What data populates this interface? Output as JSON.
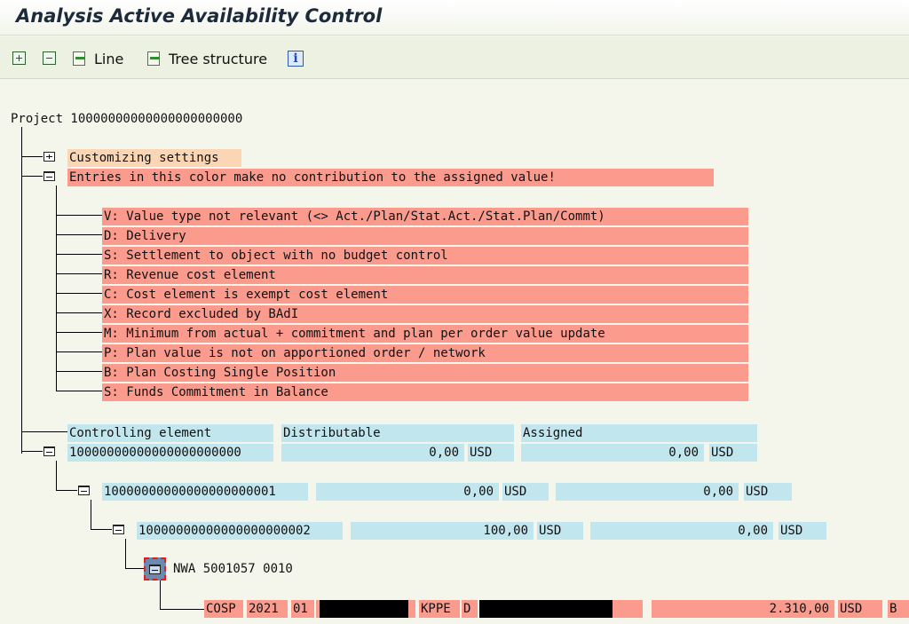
{
  "window": {
    "title": "Analysis Active Availability Control"
  },
  "toolbar": {
    "expand_icon": "expand-all-icon",
    "collapse_icon": "collapse-all-icon",
    "line_label": "Line",
    "tree_label": "Tree structure",
    "info_icon": "info-icon"
  },
  "tree": {
    "root": "Project 10000000000000000000000",
    "customizing": "Customizing settings",
    "entries_note": "Entries in this color make no contribution to the assigned value!",
    "legend": [
      "V: Value type not relevant (<> Act./Plan/Stat.Act./Stat.Plan/Commt)",
      "D: Delivery",
      "S: Settlement to object with no budget control",
      "R: Revenue cost element",
      "C: Cost element is exempt cost element",
      "X: Record excluded by BAdI",
      "M: Minimum from actual + commitment and plan per order value update",
      "P: Plan value is not on apportioned order / network",
      "B: Plan Costing Single Position",
      "S: Funds Commitment in Balance"
    ],
    "headers": {
      "element": "Controlling element",
      "distributable": "Distributable",
      "assigned": "Assigned"
    },
    "rows": [
      {
        "element": "10000000000000000000000",
        "distributable": "0,00",
        "dist_cur": "USD",
        "assigned": "0,00",
        "assigned_cur": "USD"
      },
      {
        "element": "10000000000000000000001",
        "distributable": "0,00",
        "dist_cur": "USD",
        "assigned": "0,00",
        "assigned_cur": "USD"
      },
      {
        "element": "10000000000000000000002",
        "distributable": "100,00",
        "dist_cur": "USD",
        "assigned": "0,00",
        "assigned_cur": "USD"
      }
    ],
    "network": "NWA 5001057 0010",
    "line_item": {
      "table": "COSP",
      "year": "2021",
      "period": "01",
      "cost_element_type": "KPPE",
      "indicator": "D",
      "amount": "2.310,00",
      "currency": "USD",
      "reason": "B"
    }
  },
  "colors": {
    "excluded": "#fa9b8e",
    "settings": "#fbd6b4",
    "value_cells": "#c2e6ee"
  }
}
